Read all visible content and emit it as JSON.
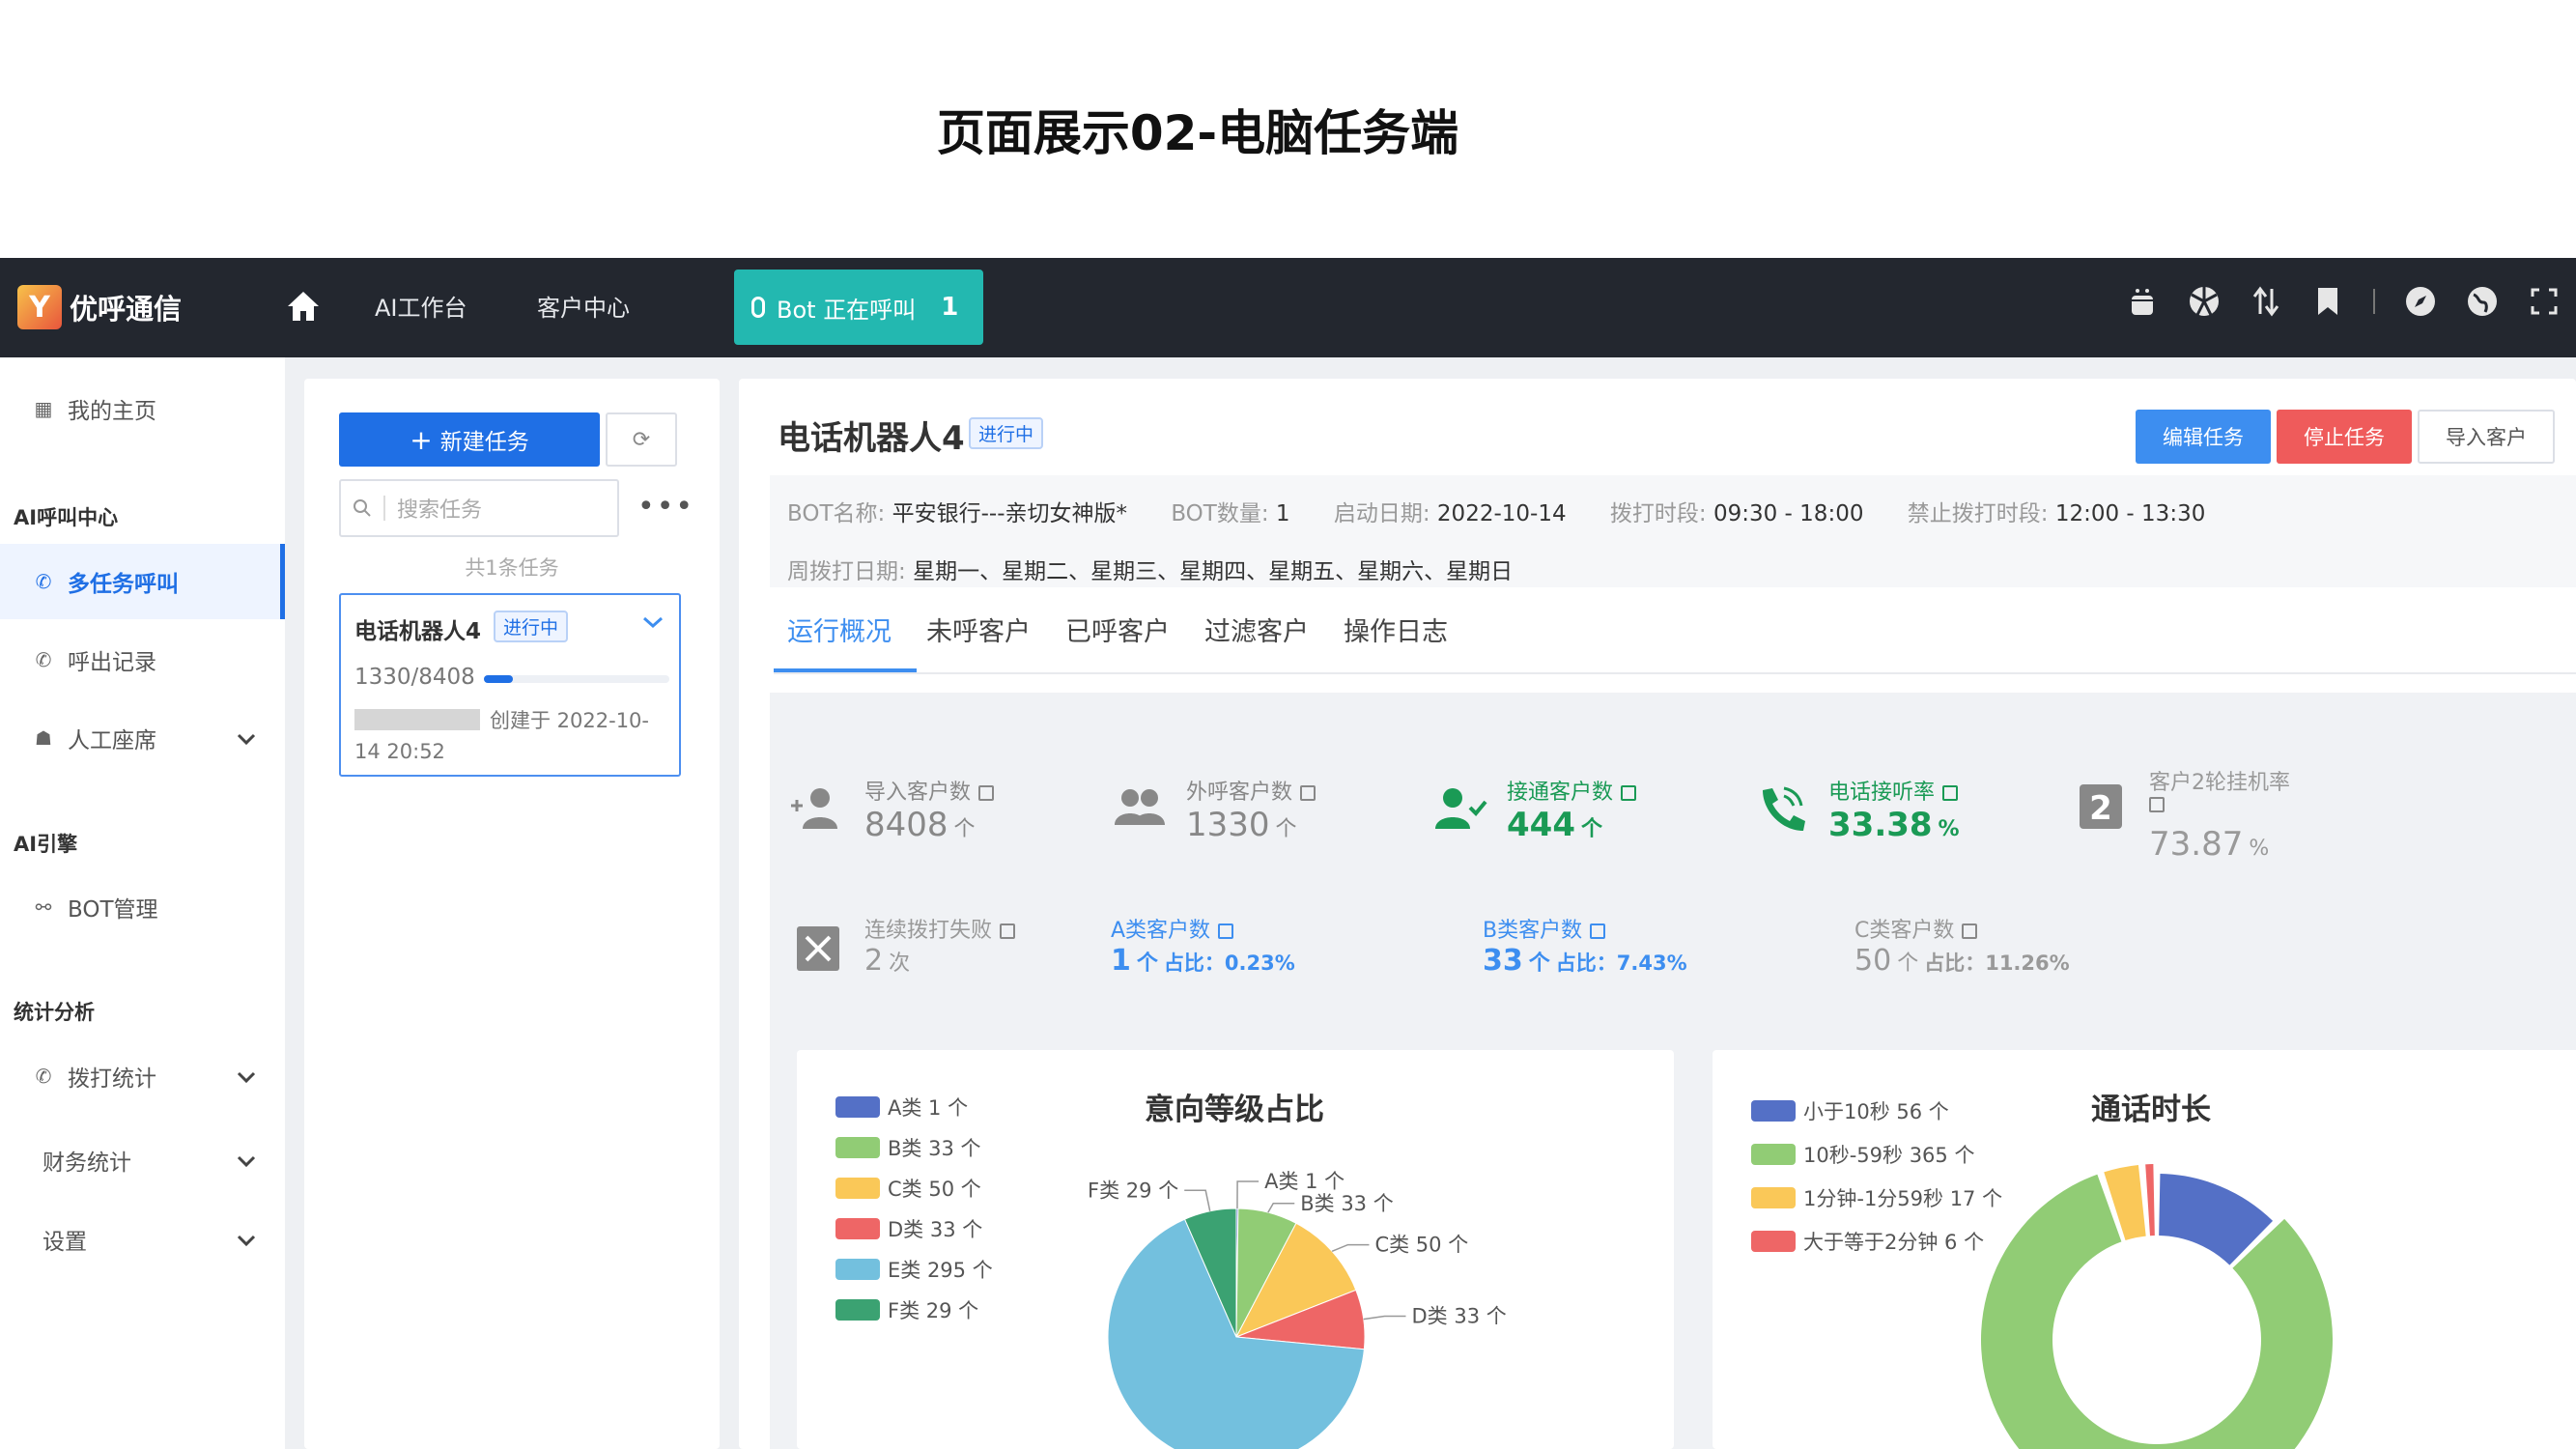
{
  "slide_title": "页面展示02-电脑任务端",
  "topbar": {
    "logo_text": "优呼通信",
    "nav": [
      "AI工作台",
      "客户中心"
    ],
    "calling_label": "Bot 正在呼叫",
    "calling_count": "1",
    "icons": [
      "android-icon",
      "aperture-icon",
      "transfer-icon",
      "bookmark-icon",
      "compass-icon",
      "globe-icon",
      "fullscreen-icon"
    ]
  },
  "sidebar": {
    "home": "我的主页",
    "group_call": "AI呼叫中心",
    "multi_task": "多任务呼叫",
    "call_records": "呼出记录",
    "agents": "人工座席",
    "group_engine": "AI引擎",
    "bot_manage": "BOT管理",
    "group_stats": "统计分析",
    "dial_stats": "拨打统计",
    "finance_stats": "财务统计",
    "settings": "设置"
  },
  "task_panel": {
    "new_task": "新建任务",
    "search_placeholder": "搜索任务",
    "count": "共1条任务",
    "task": {
      "name": "电话机器人4",
      "status": "进行中",
      "progress_text": "1330/8408",
      "progress": 0.158,
      "created": "创建于 2022-10-14 20:52"
    }
  },
  "main": {
    "title": "电话机器人4",
    "status": "进行中",
    "buttons": {
      "edit": "编辑任务",
      "stop": "停止任务",
      "import": "导入客户"
    },
    "info": {
      "bot_name_label": "BOT名称:",
      "bot_name": "平安银行---亲切女神版*",
      "bot_count_label": "BOT数量:",
      "bot_count": "1",
      "start_date_label": "启动日期:",
      "start_date": "2022-10-14",
      "dial_period_label": "拨打时段:",
      "dial_period": "09:30 - 18:00",
      "forbid_period_label": "禁止拨打时段:",
      "forbid_period": "12:00 - 13:30",
      "weekdays_label": "周拨打日期:",
      "weekdays": "星期一、星期二、星期三、星期四、星期五、星期六、星期日"
    },
    "tabs": [
      "运行概况",
      "未呼客户",
      "已呼客户",
      "过滤客户",
      "操作日志"
    ],
    "stats": {
      "imported": {
        "label": "导入客户数",
        "value": "8408",
        "unit": "个"
      },
      "called": {
        "label": "外呼客户数",
        "value": "1330",
        "unit": "个"
      },
      "connected": {
        "label": "接通客户数",
        "value": "444",
        "unit": "个"
      },
      "answer_rate": {
        "label": "电话接听率",
        "value": "33.38",
        "unit": "%"
      },
      "hangup_rate": {
        "label": "客户2轮挂机率",
        "value": "73.87",
        "unit": "%"
      },
      "consecutive_fail": {
        "label": "连续拨打失败",
        "value": "2",
        "unit": "次"
      },
      "class_a": {
        "label": "A类客户数",
        "value": "1",
        "unit": "个",
        "ratio": "占比：0.23%"
      },
      "class_b": {
        "label": "B类客户数",
        "value": "33",
        "unit": "个",
        "ratio": "占比：7.43%"
      },
      "class_c": {
        "label": "C类客户数",
        "value": "50",
        "unit": "个",
        "ratio": "占比：11.26%"
      }
    }
  },
  "chart_data": [
    {
      "type": "pie",
      "title": "意向等级占比",
      "categories": [
        "A类",
        "B类",
        "C类",
        "D类",
        "E类",
        "F类"
      ],
      "values": [
        1,
        33,
        50,
        33,
        295,
        29
      ],
      "legend": [
        "A类 1 个",
        "B类 33 个",
        "C类 50 个",
        "D类 33 个",
        "E类 295 个",
        "F类 29 个"
      ],
      "labels": [
        "A类 1 个",
        "B类 33 个",
        "C类 50 个",
        "D类 33 个",
        "F类 29 个"
      ],
      "colors": [
        "#5470c6",
        "#91cc75",
        "#fac858",
        "#ee6666",
        "#73c0de",
        "#3ba272"
      ],
      "legend_position": "left"
    },
    {
      "type": "pie",
      "title": "通话时长",
      "categories": [
        "小于10秒",
        "10秒-59秒",
        "1分钟-1分59秒",
        "大于等于2分钟"
      ],
      "values": [
        56,
        365,
        17,
        6
      ],
      "legend": [
        "小于10秒 56 个",
        "10秒-59秒 365 个",
        "1分钟-1分59秒 17 个",
        "大于等于2分钟 6 个"
      ],
      "colors": [
        "#5470c6",
        "#91cc75",
        "#fac858",
        "#ee6666"
      ],
      "legend_position": "left"
    }
  ]
}
